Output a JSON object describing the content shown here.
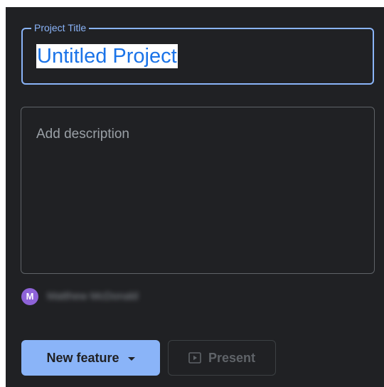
{
  "title_field": {
    "label": "Project Title",
    "value": "Untitled Project"
  },
  "description_field": {
    "placeholder": "Add description"
  },
  "owner": {
    "avatar_initial": "M",
    "name": "Matthew McDonald",
    "avatar_color": "#8e63d8"
  },
  "buttons": {
    "new_feature_label": "New feature",
    "present_label": "Present"
  },
  "icons": {
    "new_feature": "chevron-down-icon",
    "present": "play-box-icon"
  },
  "colors": {
    "accent": "#8ab4f8",
    "background": "#202124",
    "selected_text": "#1a73e8"
  }
}
